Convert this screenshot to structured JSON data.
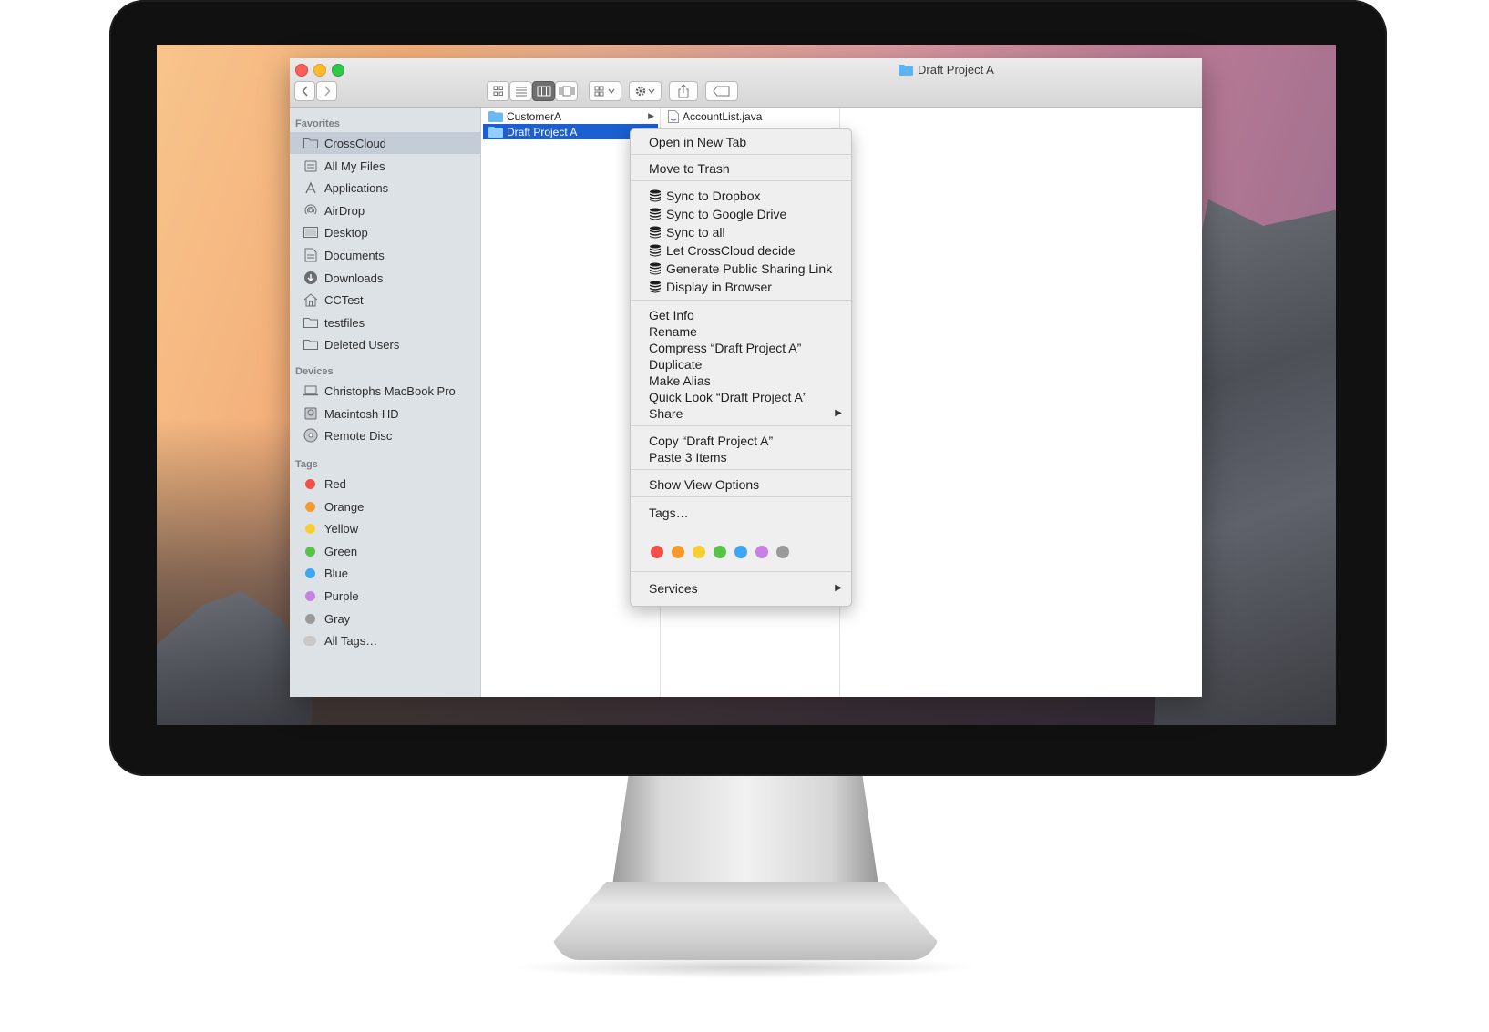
{
  "window": {
    "title": "Draft Project A"
  },
  "toolbar": {
    "view_icons": "view-icons",
    "view_list": "view-list",
    "view_columns": "view-columns",
    "view_coverflow": "view-coverflow",
    "arrange": "arrange",
    "action": "action",
    "share": "share",
    "tag": "tag"
  },
  "sidebar": {
    "favorites_header": "Favorites",
    "favorites": [
      "CrossCloud",
      "All My Files",
      "Applications",
      "AirDrop",
      "Desktop",
      "Documents",
      "Downloads",
      "CCTest",
      "testfiles",
      "Deleted Users"
    ],
    "devices_header": "Devices",
    "devices": [
      "Christophs MacBook Pro",
      "Macintosh HD",
      "Remote Disc"
    ],
    "tags_header": "Tags",
    "tags": [
      {
        "label": "Red",
        "color": "#f2504a"
      },
      {
        "label": "Orange",
        "color": "#f59a2f"
      },
      {
        "label": "Yellow",
        "color": "#f5cf33"
      },
      {
        "label": "Green",
        "color": "#58c447"
      },
      {
        "label": "Blue",
        "color": "#3ea7f1"
      },
      {
        "label": "Purple",
        "color": "#c681e3"
      },
      {
        "label": "Gray",
        "color": "#9a9a9a"
      },
      {
        "label": "All Tags…",
        "color": "#c9c9c9"
      }
    ]
  },
  "columns": {
    "col1": [
      "CustomerA",
      "Draft Project A"
    ],
    "col2": [
      "AccountList.java"
    ]
  },
  "context_menu": {
    "open_new_tab": "Open in New Tab",
    "move_to_trash": "Move to Trash",
    "sync_dropbox": "Sync to Dropbox",
    "sync_gdrive": "Sync to Google Drive",
    "sync_all": "Sync to all",
    "crosscloud_decide": "Let CrossCloud decide",
    "public_link": "Generate Public Sharing Link",
    "display_browser": "Display in Browser",
    "get_info": "Get Info",
    "rename": "Rename",
    "compress": "Compress “Draft Project A”",
    "duplicate": "Duplicate",
    "make_alias": "Make Alias",
    "quick_look": "Quick Look “Draft Project A”",
    "share": "Share",
    "copy": "Copy “Draft Project A”",
    "paste": "Paste 3 Items",
    "show_view_options": "Show View Options",
    "tags": "Tags…",
    "tag_colors": [
      "#f2504a",
      "#f59a2f",
      "#f5cf33",
      "#58c447",
      "#3ea7f1",
      "#c681e3",
      "#9a9a9a"
    ],
    "services": "Services"
  }
}
